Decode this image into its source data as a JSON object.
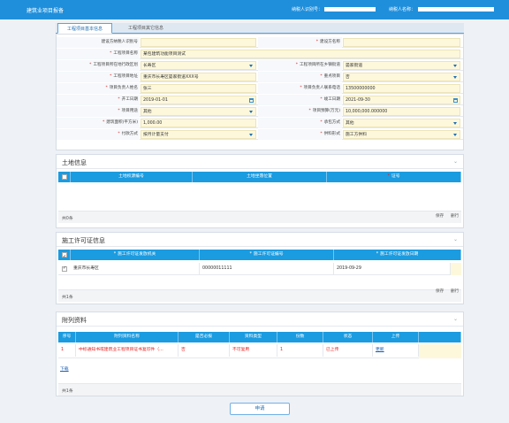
{
  "topbar": {
    "title": "建筑业项目报备",
    "user_id_label": "纳税人识别号：",
    "user_name_label": "纳税人名称："
  },
  "tabs": [
    {
      "label": "工程项目基本信息",
      "active": true
    },
    {
      "label": "工程项目其它信息",
      "active": false
    }
  ],
  "form": {
    "rows": [
      {
        "left": {
          "label": "建设方纳税人识别号",
          "required": false,
          "value": "",
          "control": "text"
        },
        "right": {
          "label": "建设方名称",
          "required": true,
          "value": "",
          "control": "text"
        }
      },
      {
        "full": {
          "label": "工程项目名称",
          "required": true,
          "value": "某包建筑功能项目测试",
          "control": "text"
        }
      },
      {
        "left": {
          "label": "工程项目所在地行政区划",
          "required": true,
          "value": "长寿区",
          "control": "select"
        },
        "right": {
          "label": "工程项目所在乡镇街道",
          "required": true,
          "value": "晏家街道",
          "control": "select"
        }
      },
      {
        "left": {
          "label": "工程项目地址",
          "required": true,
          "value": "重庆市长寿区晏家街道XXX号",
          "control": "text"
        },
        "right": {
          "label": "重点项目",
          "required": true,
          "value": "否",
          "control": "select"
        }
      },
      {
        "left": {
          "label": "项目负责人姓名",
          "required": true,
          "value": "张三",
          "control": "text"
        },
        "right": {
          "label": "项目负责人联系电话",
          "required": true,
          "value": "13500000000",
          "control": "text"
        }
      },
      {
        "left": {
          "label": "开工日期",
          "required": true,
          "value": "2019-01-01",
          "control": "date"
        },
        "right": {
          "label": "竣工日期",
          "required": true,
          "value": "2021-09-30",
          "control": "date"
        }
      },
      {
        "left": {
          "label": "项目用途",
          "required": true,
          "value": "其他",
          "control": "select"
        },
        "right": {
          "label": "项目预算(万元)",
          "required": true,
          "value": "10,000,000.000000",
          "control": "text"
        }
      },
      {
        "left": {
          "label": "建筑面积(平方米)",
          "required": true,
          "value": "1,000.00",
          "control": "text"
        },
        "right": {
          "label": "承包方式",
          "required": true,
          "value": "其他",
          "control": "select"
        }
      },
      {
        "left": {
          "label": "付款方式",
          "required": true,
          "value": "按月计量支付",
          "control": "select"
        },
        "right": {
          "label": "供料形式",
          "required": true,
          "value": "施工方供料",
          "control": "select"
        }
      }
    ]
  },
  "land": {
    "title": "土地信息",
    "columns": [
      "土地权源编号",
      "土地坐落位置",
      "证号"
    ],
    "required_columns": [
      false,
      false,
      true
    ],
    "count": "共0条",
    "actions": [
      "保存",
      "删行"
    ]
  },
  "permit": {
    "title": "施工许可证信息",
    "columns": [
      "施工许可证发放机关",
      "施工许可证编号",
      "施工许可证发放日期"
    ],
    "rows": [
      {
        "checked": true,
        "cells": [
          "重庆市长寿区",
          "00000011111",
          "2019-09-29"
        ]
      }
    ],
    "count": "共1条",
    "actions": [
      "保存",
      "删行"
    ]
  },
  "attachments": {
    "title": "附列资料",
    "columns": [
      "序号",
      "附列资料名称",
      "是否必报",
      "资料类型",
      "份数",
      "状态",
      "上传"
    ],
    "rows": [
      {
        "cells": [
          "1",
          "中标通知书或建筑业工程项目证书复印件（...",
          "否",
          "不可复用",
          "1",
          "已上传",
          "更新"
        ]
      }
    ],
    "download": "下载",
    "count": "共1条"
  },
  "submit_label": "申请",
  "colors": {
    "header": "#1f8fdc",
    "table_header": "#1b9be0",
    "required": "#e02020",
    "input_bg": "#fdf8dc"
  }
}
